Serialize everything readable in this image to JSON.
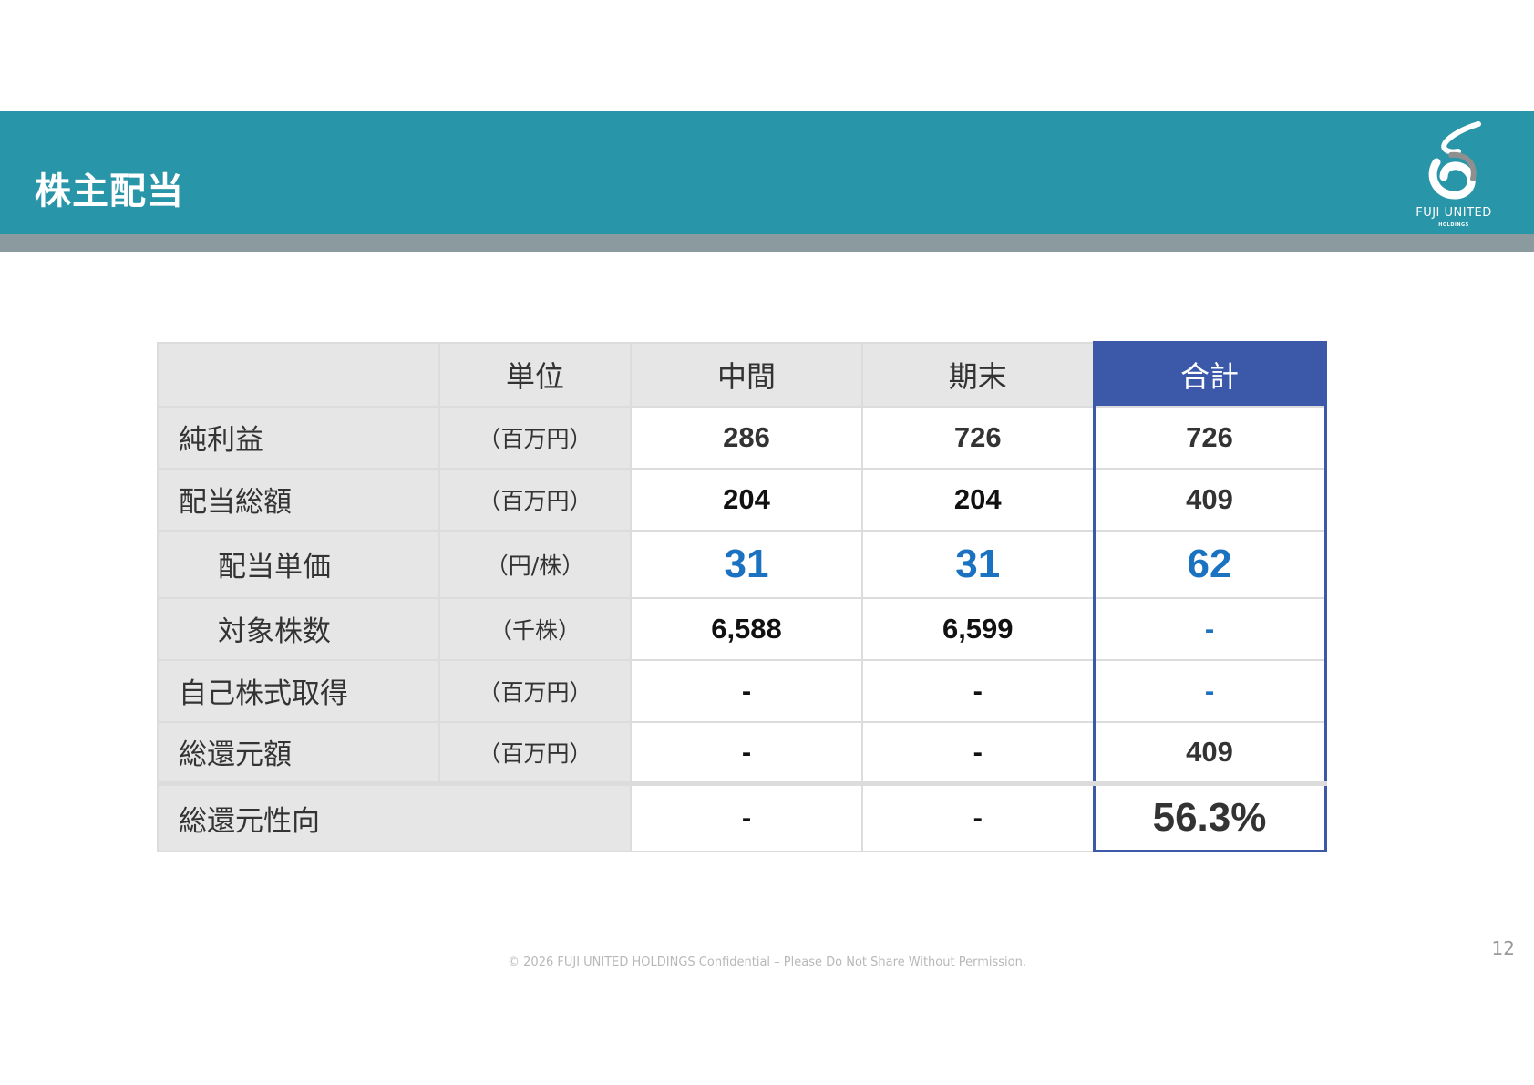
{
  "header": {
    "title": "株主配当",
    "logo": {
      "name": "FUJI UNITED",
      "sub": "HOLDINGS",
      "icon": "fuji-united-swirl-logo"
    }
  },
  "colors": {
    "header_band": "#2895a8",
    "header_underline": "#8a9a9e",
    "total_accent": "#3b59a8",
    "value_blue": "#1a72c0",
    "label_bg": "#e6e6e6"
  },
  "table": {
    "columns": [
      "",
      "単位",
      "中間",
      "期末",
      "合計"
    ],
    "rows": [
      {
        "label": "純利益",
        "unit": "（百万円）",
        "interim": "286",
        "yearend": "726",
        "total": "726"
      },
      {
        "label": "配当総額",
        "unit": "（百万円）",
        "interim": "204",
        "yearend": "204",
        "total": "409"
      },
      {
        "label": "配当単価",
        "unit": "（円/株）",
        "interim": "31",
        "yearend": "31",
        "total": "62"
      },
      {
        "label": "対象株数",
        "unit": "（千株）",
        "interim": "6,588",
        "yearend": "6,599",
        "total": "-"
      },
      {
        "label": "自己株式取得",
        "unit": "（百万円）",
        "interim": "-",
        "yearend": "-",
        "total": "-"
      },
      {
        "label": "総還元額",
        "unit": "（百万円）",
        "interim": "-",
        "yearend": "-",
        "total": "409"
      },
      {
        "label": "総還元性向",
        "unit": "",
        "interim": "-",
        "yearend": "-",
        "total": "56.3%"
      }
    ]
  },
  "footer": {
    "copyright": "© 2026 FUJI UNITED HOLDINGS Confidential – Please Do Not Share Without Permission.",
    "page_number": "12"
  }
}
